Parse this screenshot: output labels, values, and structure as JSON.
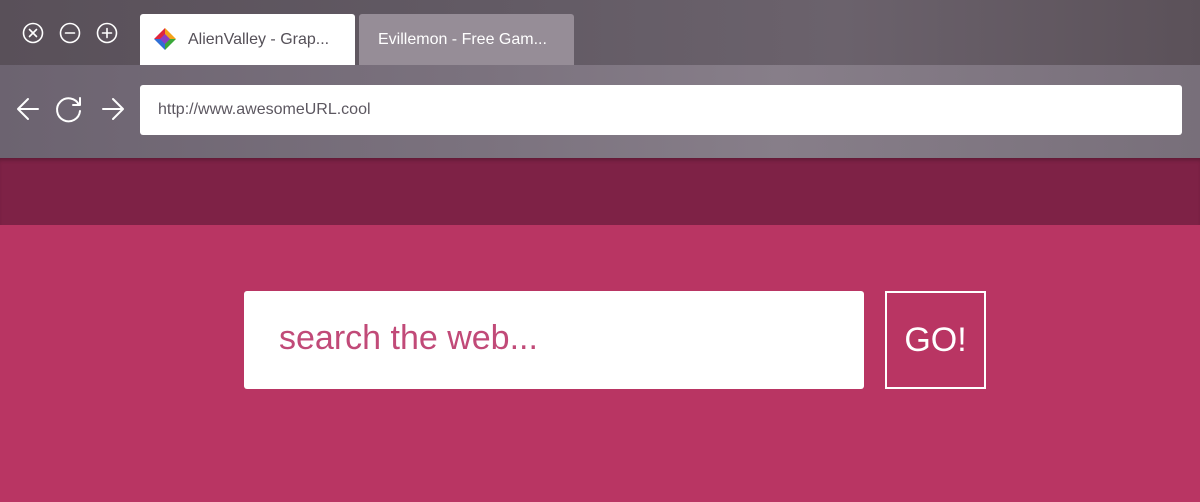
{
  "window_controls": {
    "close_icon": "close-icon",
    "minimize_icon": "minimize-icon",
    "maximize_icon": "maximize-icon"
  },
  "tabs": [
    {
      "title": "AlienValley - Grap...",
      "favicon": "multicolor-diamond-icon",
      "active": true
    },
    {
      "title": "Evillemon - Free Gam...",
      "active": false
    }
  ],
  "navigation": {
    "back_icon": "arrow-left-icon",
    "reload_icon": "reload-icon",
    "forward_icon": "arrow-right-icon"
  },
  "address_bar": {
    "url": "http://www.awesomeURL.cool"
  },
  "search": {
    "placeholder": "search the web...",
    "button_label": "GO!"
  },
  "colors": {
    "chrome": "#6f6672",
    "page_header": "#7e2246",
    "page_body": "#b93563",
    "search_placeholder": "#c14a78"
  }
}
